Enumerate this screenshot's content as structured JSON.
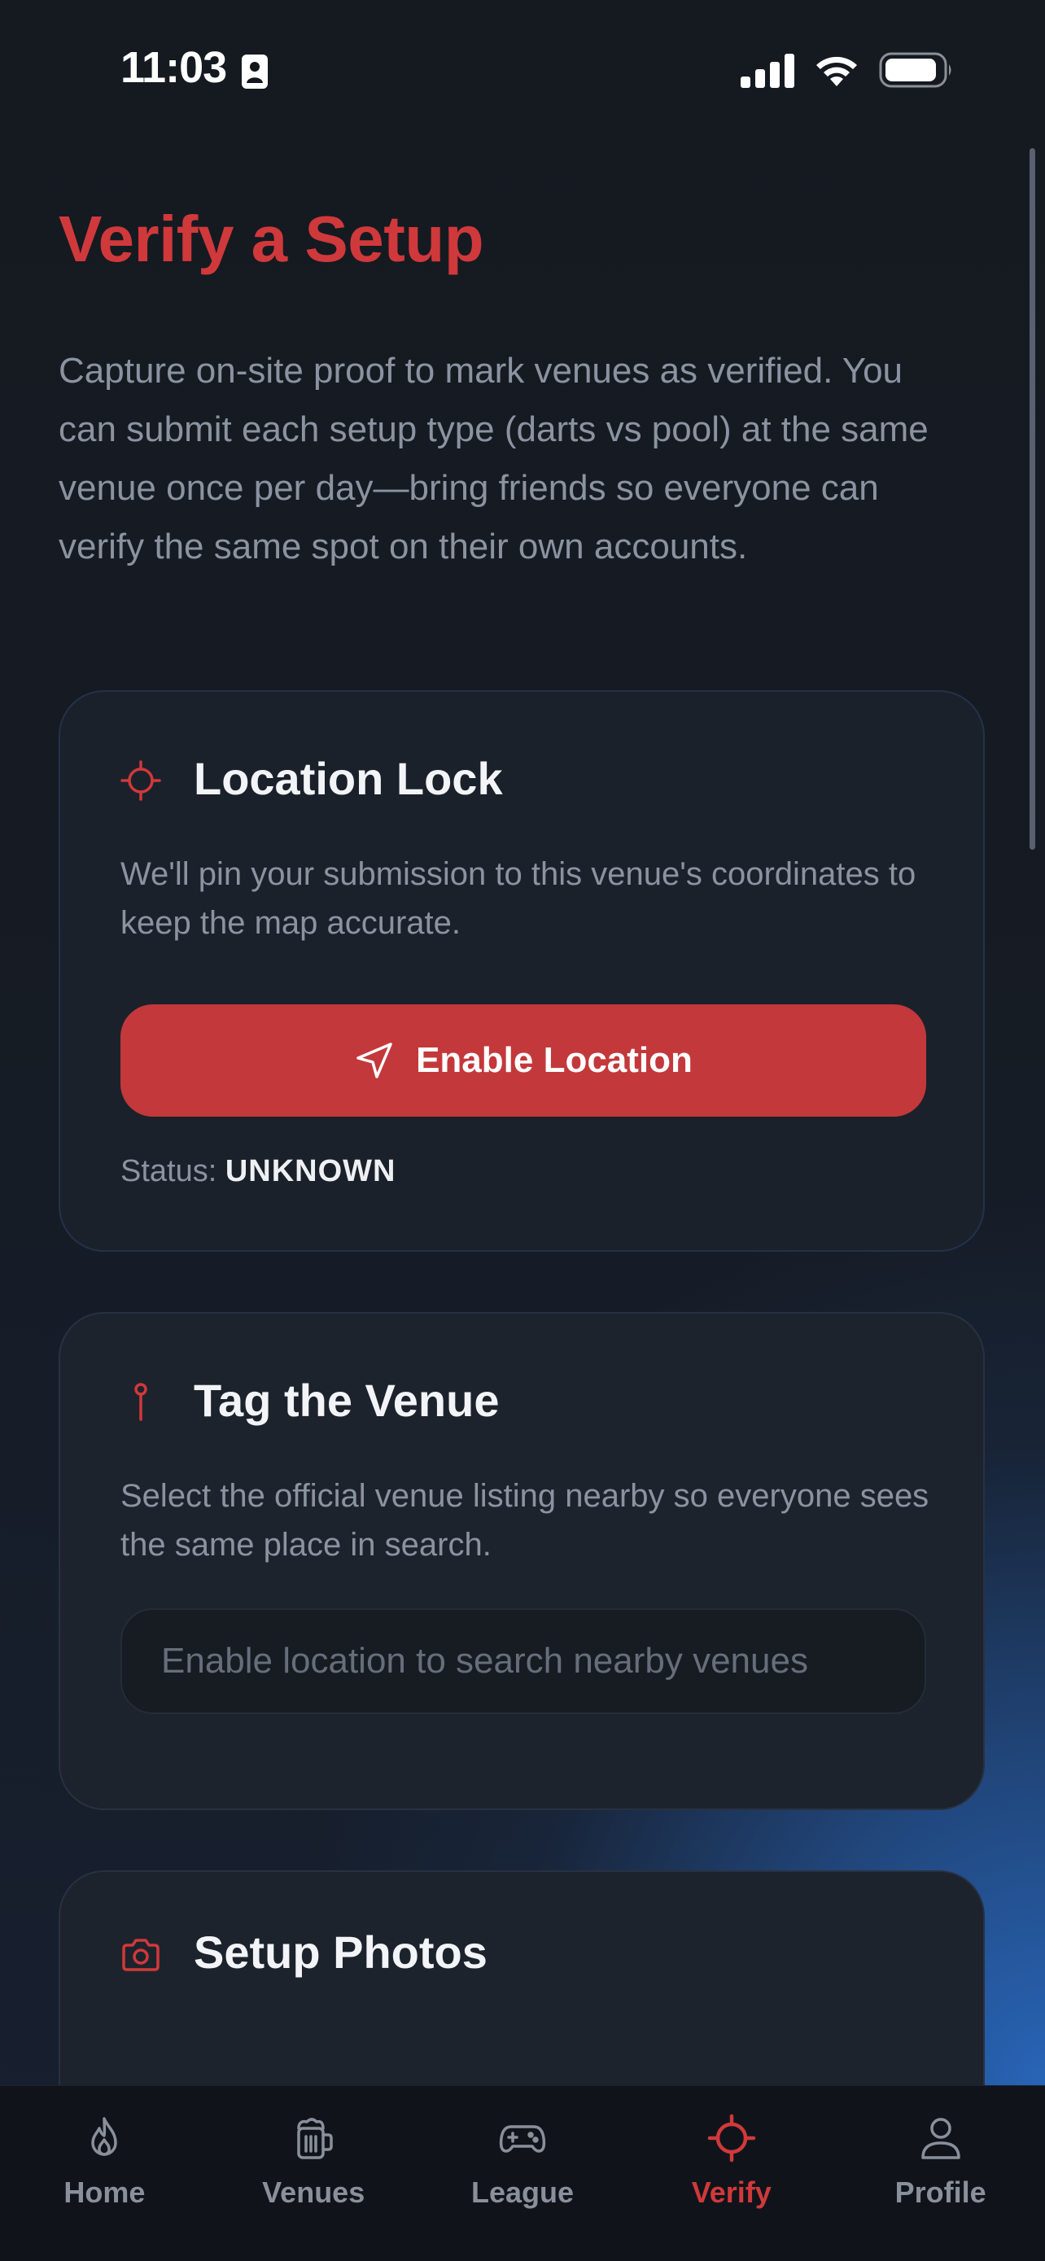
{
  "status_bar": {
    "time": "11:03"
  },
  "page": {
    "title": "Verify a Setup",
    "intro": "Capture on-site proof to mark venues as verified. You can submit each setup type (darts vs pool) at the same venue once per day—bring friends so everyone can verify the same spot on their own accounts."
  },
  "location_card": {
    "icon": "crosshair-icon",
    "title": "Location Lock",
    "description": "We'll pin your submission to this venue's coordinates to keep the map accurate.",
    "button_label": "Enable Location",
    "status_label": "Status:",
    "status_value": "UNKNOWN"
  },
  "venue_card": {
    "icon": "pin-icon",
    "title": "Tag the Venue",
    "description": "Select the official venue listing nearby so everyone sees the same place in search.",
    "search_placeholder": "Enable location to search nearby venues",
    "search_value": ""
  },
  "photos_card": {
    "icon": "camera-icon",
    "title": "Setup Photos"
  },
  "tabs": [
    {
      "label": "Home",
      "icon": "flame-icon",
      "active": false
    },
    {
      "label": "Venues",
      "icon": "beer-mug-icon",
      "active": false
    },
    {
      "label": "League",
      "icon": "gamepad-icon",
      "active": false
    },
    {
      "label": "Verify",
      "icon": "crosshair-icon",
      "active": true
    },
    {
      "label": "Profile",
      "icon": "person-icon",
      "active": false
    }
  ],
  "colors": {
    "accent": "#d0393b",
    "button": "#c3383b",
    "muted_text": "#8b93a1",
    "card_bg": "#1d232d",
    "tab_bar_bg": "#10141a"
  }
}
